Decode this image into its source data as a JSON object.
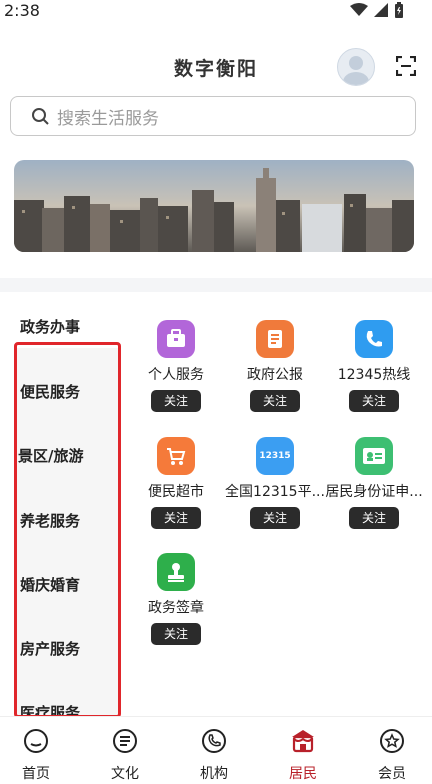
{
  "status": {
    "time": "2:38"
  },
  "header": {
    "title": "数字衡阳"
  },
  "search": {
    "placeholder": "搜索生活服务"
  },
  "categories": [
    {
      "label": "政务办事"
    },
    {
      "label": "便民服务"
    },
    {
      "label": "景区/旅游"
    },
    {
      "label": "养老服务"
    },
    {
      "label": "婚庆婚育"
    },
    {
      "label": "房产服务"
    },
    {
      "label": "医疗服务"
    }
  ],
  "services": [
    {
      "label": "个人服务",
      "follow": "关注",
      "color": "#b266d9"
    },
    {
      "label": "政府公报",
      "follow": "关注",
      "color": "#f07a3b"
    },
    {
      "label": "12345热线",
      "follow": "关注",
      "color": "#2f9cf0"
    },
    {
      "label": "便民超市",
      "follow": "关注",
      "color": "#f57a3a"
    },
    {
      "label": "全国12315平...",
      "follow": "关注",
      "color": "#3b9ef2",
      "badge": "12315"
    },
    {
      "label": "居民身份证申...",
      "follow": "关注",
      "color": "#3dbf72"
    },
    {
      "label": "政务签章",
      "follow": "关注",
      "color": "#2eaf4b"
    }
  ],
  "nav": [
    {
      "label": "首页"
    },
    {
      "label": "文化"
    },
    {
      "label": "机构"
    },
    {
      "label": "居民"
    },
    {
      "label": "会员"
    }
  ],
  "colors": {
    "accent": "#b8212a",
    "highlight": "#e0262b"
  }
}
